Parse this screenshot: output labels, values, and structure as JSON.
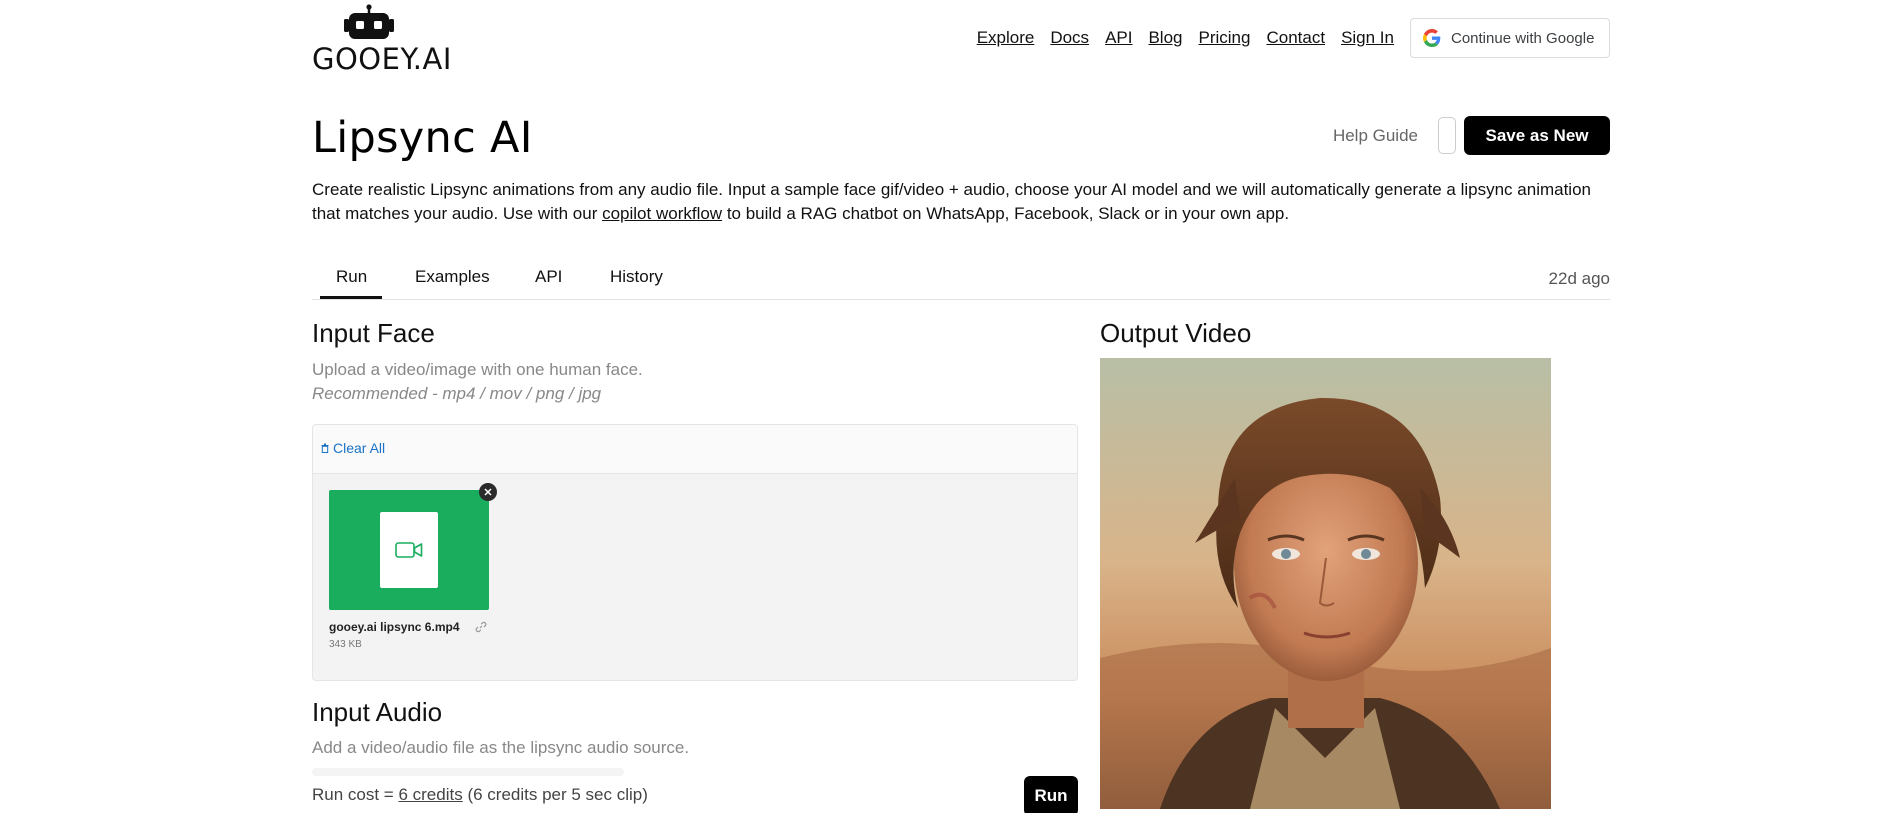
{
  "header": {
    "logo_text": "GOOEY.AI",
    "nav": [
      "Explore",
      "Docs",
      "API",
      "Blog",
      "Pricing",
      "Contact",
      "Sign In"
    ],
    "google_button": "Continue with Google"
  },
  "page": {
    "title": "Lipsync AI",
    "help_guide": "Help Guide",
    "save_button": "Save as New",
    "description_before": "Create realistic Lipsync animations from any audio file. Input a sample face gif/video + audio, choose your AI model and we will automatically generate a lipsync animation that matches your audio. Use with our ",
    "description_link": "copilot workflow",
    "description_after": " to build a RAG chatbot on WhatsApp, Facebook, Slack or in your own app."
  },
  "tabs": {
    "items": [
      "Run",
      "Examples",
      "API",
      "History"
    ],
    "active": "Run",
    "timestamp": "22d ago"
  },
  "input_face": {
    "title": "Input Face",
    "help": "Upload a video/image with one human face.",
    "recommended": "Recommended - mp4 / mov / png / jpg",
    "clear_all": "Clear All",
    "file": {
      "name": "gooey.ai lipsync 6.mp4",
      "size": "343 KB"
    }
  },
  "input_audio": {
    "title": "Input Audio",
    "help": "Add a video/audio file as the lipsync audio source."
  },
  "run": {
    "cost_prefix": "Run cost = ",
    "cost_link": "6 credits",
    "cost_suffix": " (6 credits per 5 sec clip)",
    "button": "Run"
  },
  "output": {
    "title": "Output Video"
  },
  "colors": {
    "file_thumb": "#1aad5e",
    "link_blue": "#1a73c8",
    "primary_button": "#000000"
  }
}
